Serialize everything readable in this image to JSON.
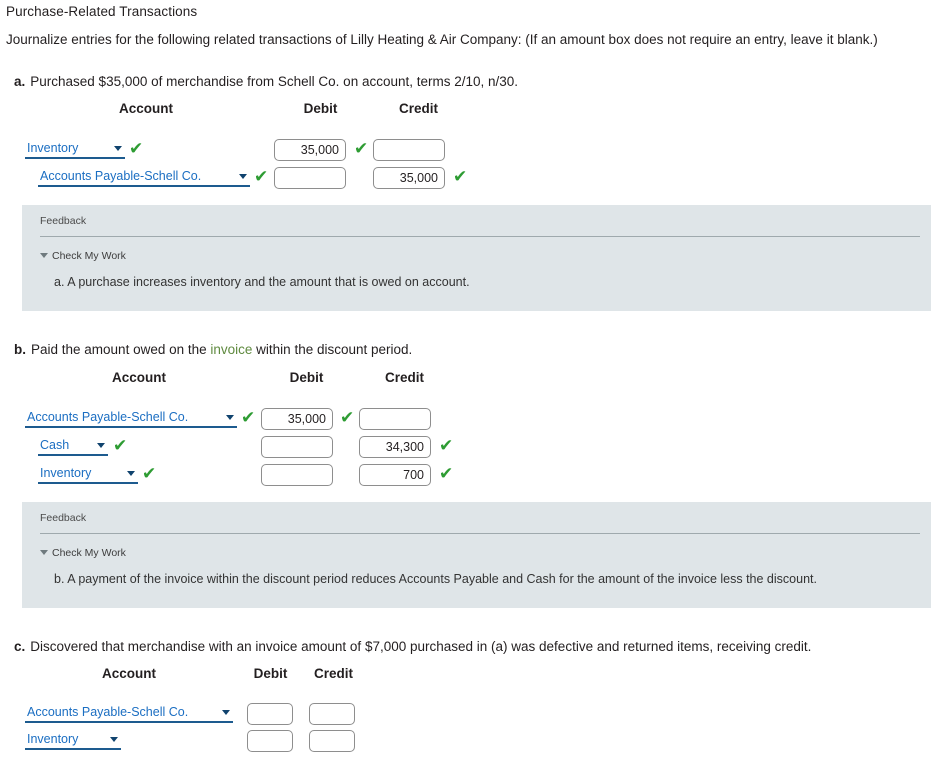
{
  "page": {
    "title": "Purchase-Related Transactions",
    "instruction": "Journalize entries for the following related transactions of Lilly Heating & Air Company: (If an amount box does not require an entry, leave it blank.)"
  },
  "columns": {
    "account": "Account",
    "debit": "Debit",
    "credit": "Credit"
  },
  "colors": {
    "check_green": "#2e9c33",
    "link_blue": "#1b6ec2",
    "select_underline": "#1d5b8f",
    "feedback_bg": "#dfe5e8",
    "glossary_green": "#5f8a3f",
    "text": "#231f20"
  },
  "icons": {
    "check": "✔",
    "caret_down": "▼"
  },
  "parts": [
    {
      "letter": "a.",
      "prompt_before": "Purchased $35,000 of merchandise from Schell Co. on account, terms 2/10, n/30.",
      "prompt_link": "",
      "prompt_after": "",
      "rows": [
        {
          "account": "Inventory",
          "account_checked": true,
          "debit": "35,000",
          "debit_checked": true,
          "credit": "",
          "credit_checked": false
        },
        {
          "account": "Accounts Payable-Schell Co.",
          "account_checked": true,
          "debit": "",
          "debit_checked": false,
          "credit": "35,000",
          "credit_checked": true
        }
      ],
      "feedback": {
        "title": "Feedback",
        "check_my_work": "Check My Work",
        "text": "a. A purchase increases inventory and the amount that is owed on account."
      }
    },
    {
      "letter": "b.",
      "prompt_before": "Paid the amount owed on the ",
      "prompt_link": "invoice",
      "prompt_after": " within the discount period.",
      "rows": [
        {
          "account": "Accounts Payable-Schell Co.",
          "account_checked": true,
          "debit": "35,000",
          "debit_checked": true,
          "credit": "",
          "credit_checked": false
        },
        {
          "account": "Cash",
          "account_checked": true,
          "debit": "",
          "debit_checked": false,
          "credit": "34,300",
          "credit_checked": true
        },
        {
          "account": "Inventory",
          "account_checked": true,
          "debit": "",
          "debit_checked": false,
          "credit": "700",
          "credit_checked": true
        }
      ],
      "feedback": {
        "title": "Feedback",
        "check_my_work": "Check My Work",
        "text": "b. A payment of the invoice within the discount period reduces Accounts Payable and Cash for the amount of the invoice less the discount."
      }
    },
    {
      "letter": "c.",
      "prompt_before": "Discovered that merchandise with an invoice amount of $7,000 purchased in (a) was defective and returned items, receiving credit.",
      "prompt_link": "",
      "prompt_after": "",
      "rows": [
        {
          "account": "Accounts Payable-Schell Co.",
          "account_checked": false,
          "debit": "",
          "debit_checked": false,
          "credit": "",
          "credit_checked": false
        },
        {
          "account": "Inventory",
          "account_checked": false,
          "debit": "",
          "debit_checked": false,
          "credit": "",
          "credit_checked": false
        }
      ],
      "feedback": null
    }
  ]
}
